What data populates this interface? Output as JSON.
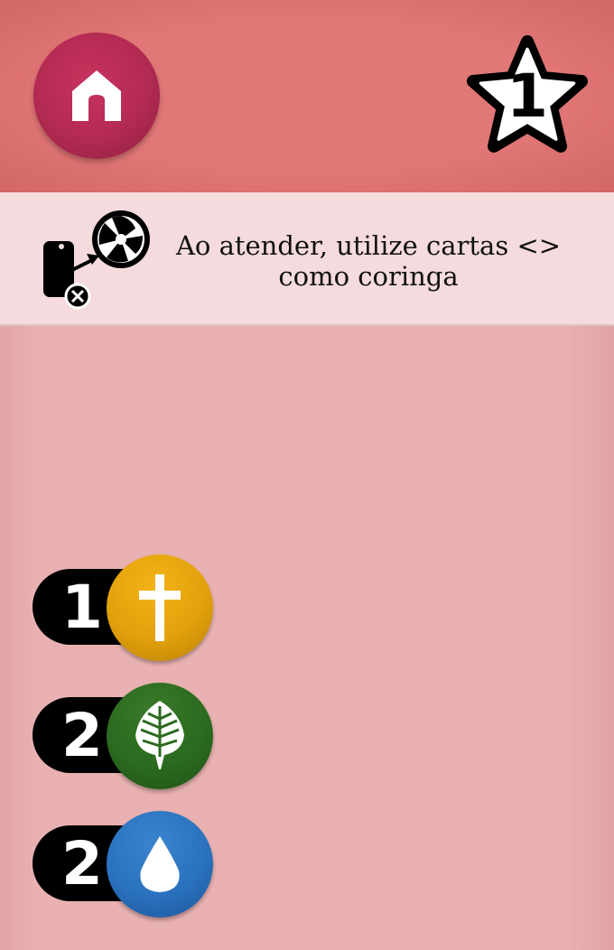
{
  "header": {
    "home_icon": "home-icon",
    "level": "1",
    "level_icon": "star-icon"
  },
  "info": {
    "icon": "card-swap-icon",
    "text": "Ao atender, utilize cartas <> como coringa"
  },
  "resources": [
    {
      "count": "1",
      "icon": "cross-icon",
      "color": "#e2a10b"
    },
    {
      "count": "2",
      "icon": "leaf-icon",
      "color": "#2b6a1f"
    },
    {
      "count": "2",
      "icon": "water-drop-icon",
      "color": "#2a72be"
    }
  ],
  "colors": {
    "header": "#e27777",
    "home_button": "#b22a52",
    "info_bar": "#f5dbdd",
    "background": "#e9b1b1"
  }
}
